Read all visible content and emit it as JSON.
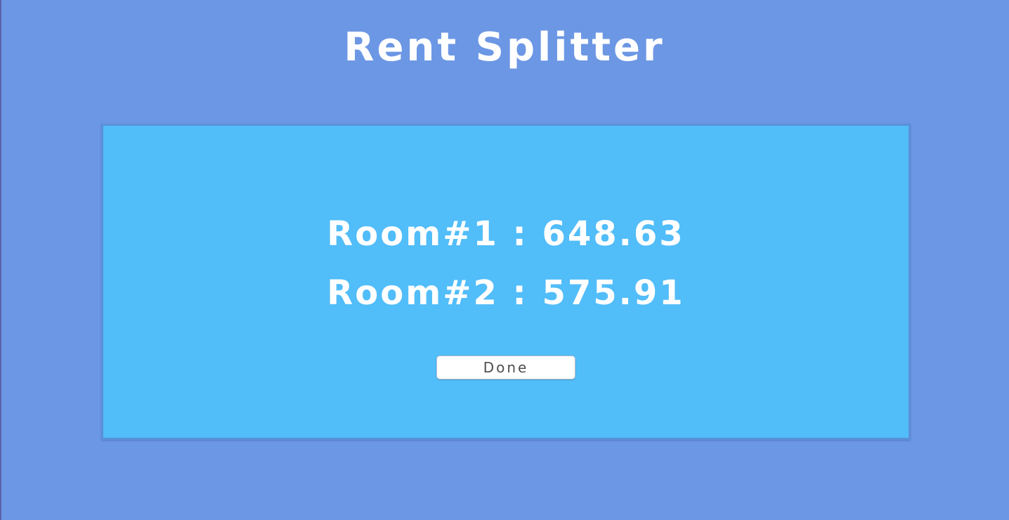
{
  "header": {
    "title": "Rent Splitter"
  },
  "results": {
    "rooms": [
      {
        "label": "Room#1",
        "separator": ":",
        "amount": "648.63",
        "text": "Room#1 : 648.63"
      },
      {
        "label": "Room#2",
        "separator": ":",
        "amount": "575.91",
        "text": "Room#2 : 575.91"
      }
    ],
    "done_label": "Done"
  },
  "colors": {
    "page_background": "#6c97e4",
    "panel_background": "#51bdf9",
    "panel_border": "#5b91d7",
    "text": "#ffffff",
    "button_background": "#ffffff",
    "button_text": "#4e4e4e"
  }
}
